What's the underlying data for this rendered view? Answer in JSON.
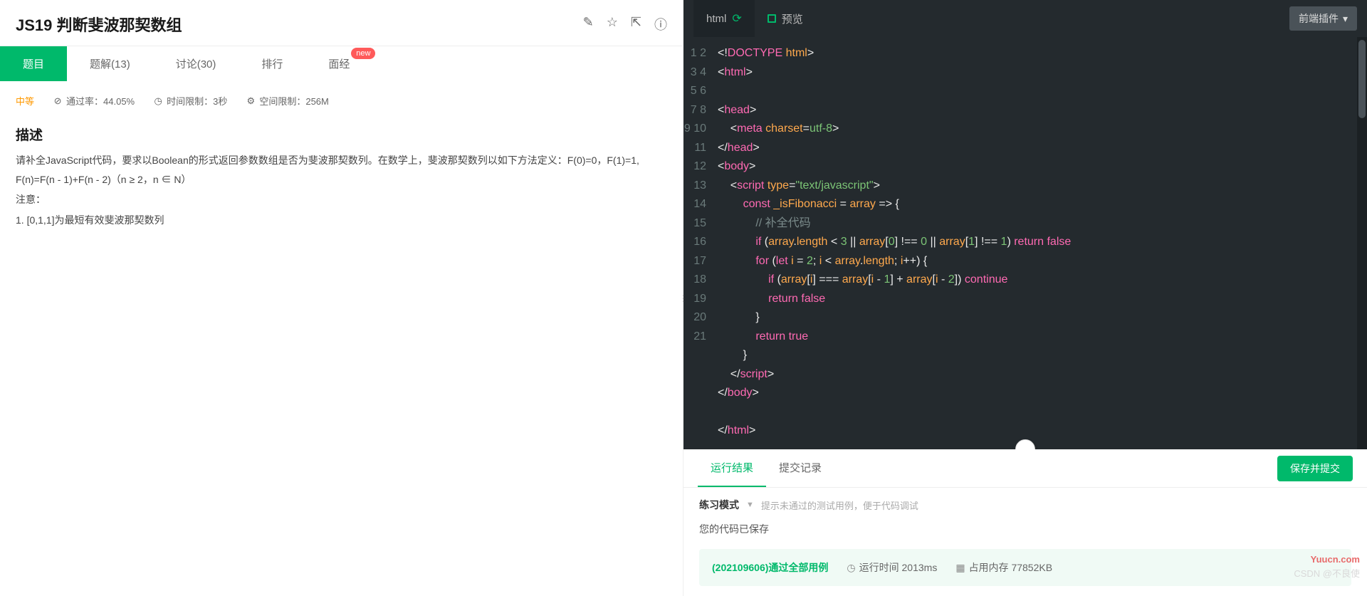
{
  "title": "JS19  判断斐波那契数组",
  "titleActions": [
    "edit",
    "star",
    "share",
    "info"
  ],
  "tabs": [
    {
      "label": "题目",
      "active": true
    },
    {
      "label": "题解(13)"
    },
    {
      "label": "讨论(30)"
    },
    {
      "label": "排行"
    },
    {
      "label": "面经",
      "badge": "new"
    }
  ],
  "meta": {
    "difficulty": "中等",
    "passRate": "通过率：44.05%",
    "timeLimit": "时间限制：3秒",
    "spaceLimit": "空间限制：256M"
  },
  "descHeading": "描述",
  "descLines": [
    "请补全JavaScript代码，要求以Boolean的形式返回参数数组是否为斐波那契数列。在数学上，斐波那契数列以如下方法定义：F(0)=0，F(1)=1, F(n)=F(n - 1)+F(n - 2)（n ≥ 2，n ∈ N）",
    "注意：",
    "1. [0,1,1]为最短有效斐波那契数列"
  ],
  "editor": {
    "tab1": "html",
    "tab2": "预览",
    "pluginBtn": "前端插件"
  },
  "codeLines": 21,
  "result": {
    "tab1": "运行结果",
    "tab2": "提交记录",
    "submit": "保存并提交",
    "modeLabel": "练习模式",
    "modeDesc": "提示未通过的测试用例，便于代码调试",
    "savedMsg": "您的代码已保存",
    "passId": "(202109606)通过全部用例",
    "runtime": "运行时间 2013ms",
    "memory": "占用内存 77852KB"
  },
  "watermark": {
    "site": "Yuucn.com",
    "credit": "CSDN @不良使"
  }
}
